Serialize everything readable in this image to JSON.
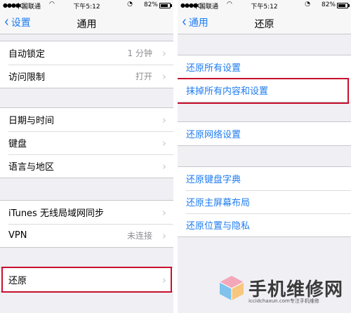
{
  "status_bar": {
    "carrier": "中国联通",
    "time": "下午5:12",
    "battery": "82%"
  },
  "left": {
    "nav": {
      "back_label": "设置",
      "title": "通用"
    },
    "groups": [
      [
        {
          "label": "自动锁定",
          "value": "1 分钟"
        },
        {
          "label": "访问限制",
          "value": "打开"
        }
      ],
      [
        {
          "label": "日期与时间"
        },
        {
          "label": "键盘"
        },
        {
          "label": "语言与地区"
        }
      ],
      [
        {
          "label": "iTunes 无线局域网同步"
        },
        {
          "label": "VPN",
          "value": "未连接"
        }
      ],
      [
        {
          "label": "还原"
        }
      ]
    ]
  },
  "right": {
    "nav": {
      "back_label": "通用",
      "title": "还原"
    },
    "groups": [
      [
        {
          "label": "还原所有设置"
        },
        {
          "label": "抹掉所有内容和设置"
        }
      ],
      [
        {
          "label": "还原网络设置"
        }
      ],
      [
        {
          "label": "还原键盘字典"
        },
        {
          "label": "还原主屏幕布局"
        },
        {
          "label": "还原位置与隐私"
        }
      ]
    ]
  },
  "watermark": {
    "title": "手机维修网",
    "subtitle": "iccidchaxun.com专注手机维修"
  },
  "colors": {
    "accent": "#1e7cf2",
    "highlight": "#c8102e",
    "background": "#efeff4"
  }
}
